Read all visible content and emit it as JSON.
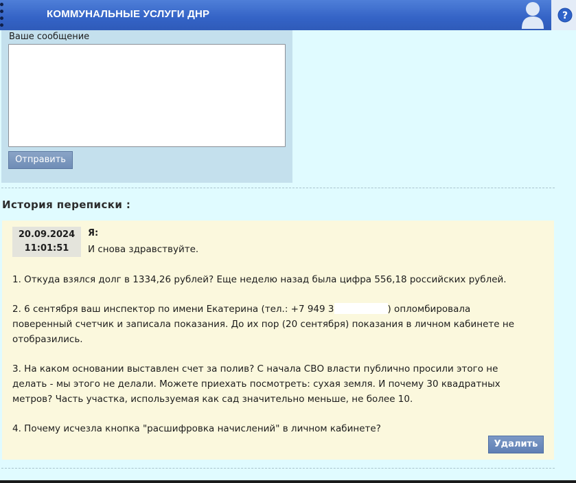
{
  "header": {
    "title": "КОММУНАЛЬНЫЕ УСЛУГИ ДНР",
    "icons": [
      "menu-icon",
      "user-icon",
      "help-icon"
    ],
    "colors": {
      "header_bg": "#3463c6",
      "page_bg": "#e0fbff"
    }
  },
  "compose": {
    "label": "Ваше сообщение",
    "value": "",
    "send_label": "Отправить"
  },
  "history": {
    "title": "История переписки :",
    "messages": [
      {
        "date": "20.09.2024",
        "time": "11:01:51",
        "author": "Я:",
        "greeting": "И снова здравствуйте.",
        "p1": "1. Откуда взялся долг в 1334,26 рублей? Еще неделю назад была цифра 556,18 российских рублей.",
        "p2a": "2. 6 сентября ваш инспектор по имени Екатерина (тел.: +7 949 3",
        "p2b": ") опломбировала",
        "p2c": "поверенный счетчик и записала показания. До их пор (20 сентября) показания в личном кабинете не",
        "p2d": "отобразились.",
        "p3a": "3. На каком основании выставлен счет за полив? С начала СВО власти публично просили этого не",
        "p3b": "делать - мы этого не делали. Можете приехать посмотреть: сухая земля. И почему 30 квадратных",
        "p3c": "метров? Часть участка, используемая как сад значительно меньше, не более 10.",
        "p4": "4. Почему исчезла кнопка \"расшифровка начислений\" в личном кабинете?",
        "delete_label": "Удалить"
      }
    ]
  }
}
